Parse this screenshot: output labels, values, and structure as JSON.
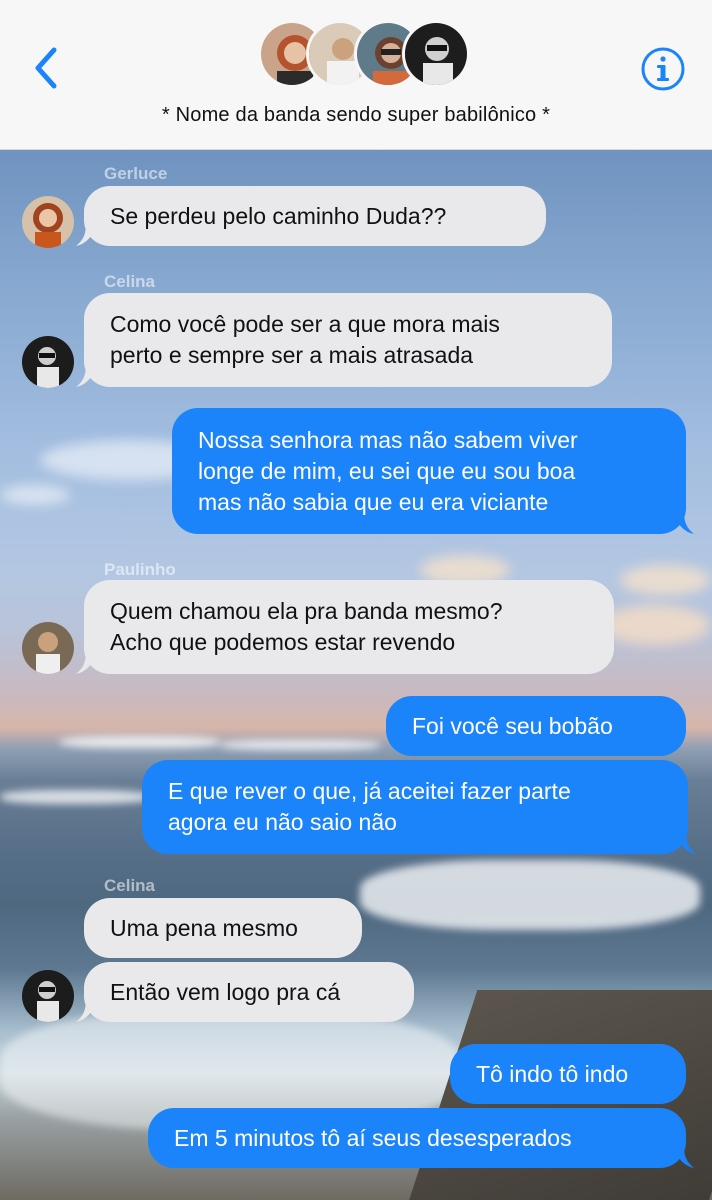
{
  "header": {
    "title": "* Nome da banda sendo super babilônico *",
    "back_icon": "chevron-left-icon",
    "info_icon": "info-icon",
    "accent": "#1b84fb"
  },
  "messages": [
    {
      "sender": "Gerluce",
      "text": "Se perdeu pelo caminho Duda??",
      "dir": "in"
    },
    {
      "sender": "Celina",
      "text": "Como você pode ser a que mora mais\nperto e sempre ser a mais atrasada",
      "dir": "in"
    },
    {
      "text": "Nossa senhora mas não sabem viver\nlonge de mim, eu sei que eu sou boa\nmas não sabia que eu era viciante",
      "dir": "out"
    },
    {
      "sender": "Paulinho",
      "text": "Quem chamou ela pra banda mesmo?\nAcho que podemos estar revendo",
      "dir": "in"
    },
    {
      "text": "Foi você seu bobão",
      "dir": "out"
    },
    {
      "text": "E que rever o que, já aceitei fazer parte\nagora eu não saio não",
      "dir": "out"
    },
    {
      "sender": "Celina",
      "text": "Uma pena mesmo",
      "dir": "in"
    },
    {
      "text": "Então vem logo pra cá",
      "dir": "in"
    },
    {
      "text": "Tô indo tô indo",
      "dir": "out"
    },
    {
      "text": "Em 5 minutos tô aí seus desesperados",
      "dir": "out"
    }
  ],
  "colors": {
    "incoming_bubble": "#e9e9eb",
    "outgoing_bubble": "#1b84fb"
  }
}
